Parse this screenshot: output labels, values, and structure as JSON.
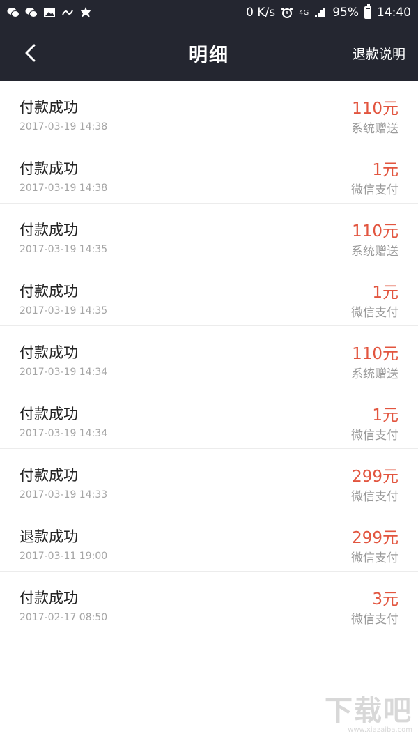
{
  "status_bar": {
    "network_speed": "0 K/s",
    "network_type": "4G",
    "battery": "95%",
    "time": "14:40",
    "icons": [
      "wechat-icon",
      "wechat-icon",
      "image-icon",
      "link-icon",
      "leaf-icon",
      "alarm-icon",
      "signal-icon",
      "battery-icon"
    ]
  },
  "nav": {
    "title": "明细",
    "action": "退款说明"
  },
  "colors": {
    "header_bg": "#242630",
    "amount": "#e2553f",
    "divider": "#ececec"
  },
  "records": [
    {
      "title": "付款成功",
      "time": "2017-03-19 14:38",
      "amount": "110元",
      "method": "系统赠送"
    },
    {
      "title": "付款成功",
      "time": "2017-03-19 14:38",
      "amount": "1元",
      "method": "微信支付"
    },
    {
      "title": "付款成功",
      "time": "2017-03-19 14:35",
      "amount": "110元",
      "method": "系统赠送"
    },
    {
      "title": "付款成功",
      "time": "2017-03-19 14:35",
      "amount": "1元",
      "method": "微信支付"
    },
    {
      "title": "付款成功",
      "time": "2017-03-19 14:34",
      "amount": "110元",
      "method": "系统赠送"
    },
    {
      "title": "付款成功",
      "time": "2017-03-19 14:34",
      "amount": "1元",
      "method": "微信支付"
    },
    {
      "title": "付款成功",
      "time": "2017-03-19 14:33",
      "amount": "299元",
      "method": "微信支付"
    },
    {
      "title": "退款成功",
      "time": "2017-03-11 19:00",
      "amount": "299元",
      "method": "微信支付"
    },
    {
      "title": "付款成功",
      "time": "2017-02-17 08:50",
      "amount": "3元",
      "method": "微信支付"
    }
  ],
  "watermark": {
    "logo": "下载吧",
    "url": "www.xiazaiba.com"
  }
}
